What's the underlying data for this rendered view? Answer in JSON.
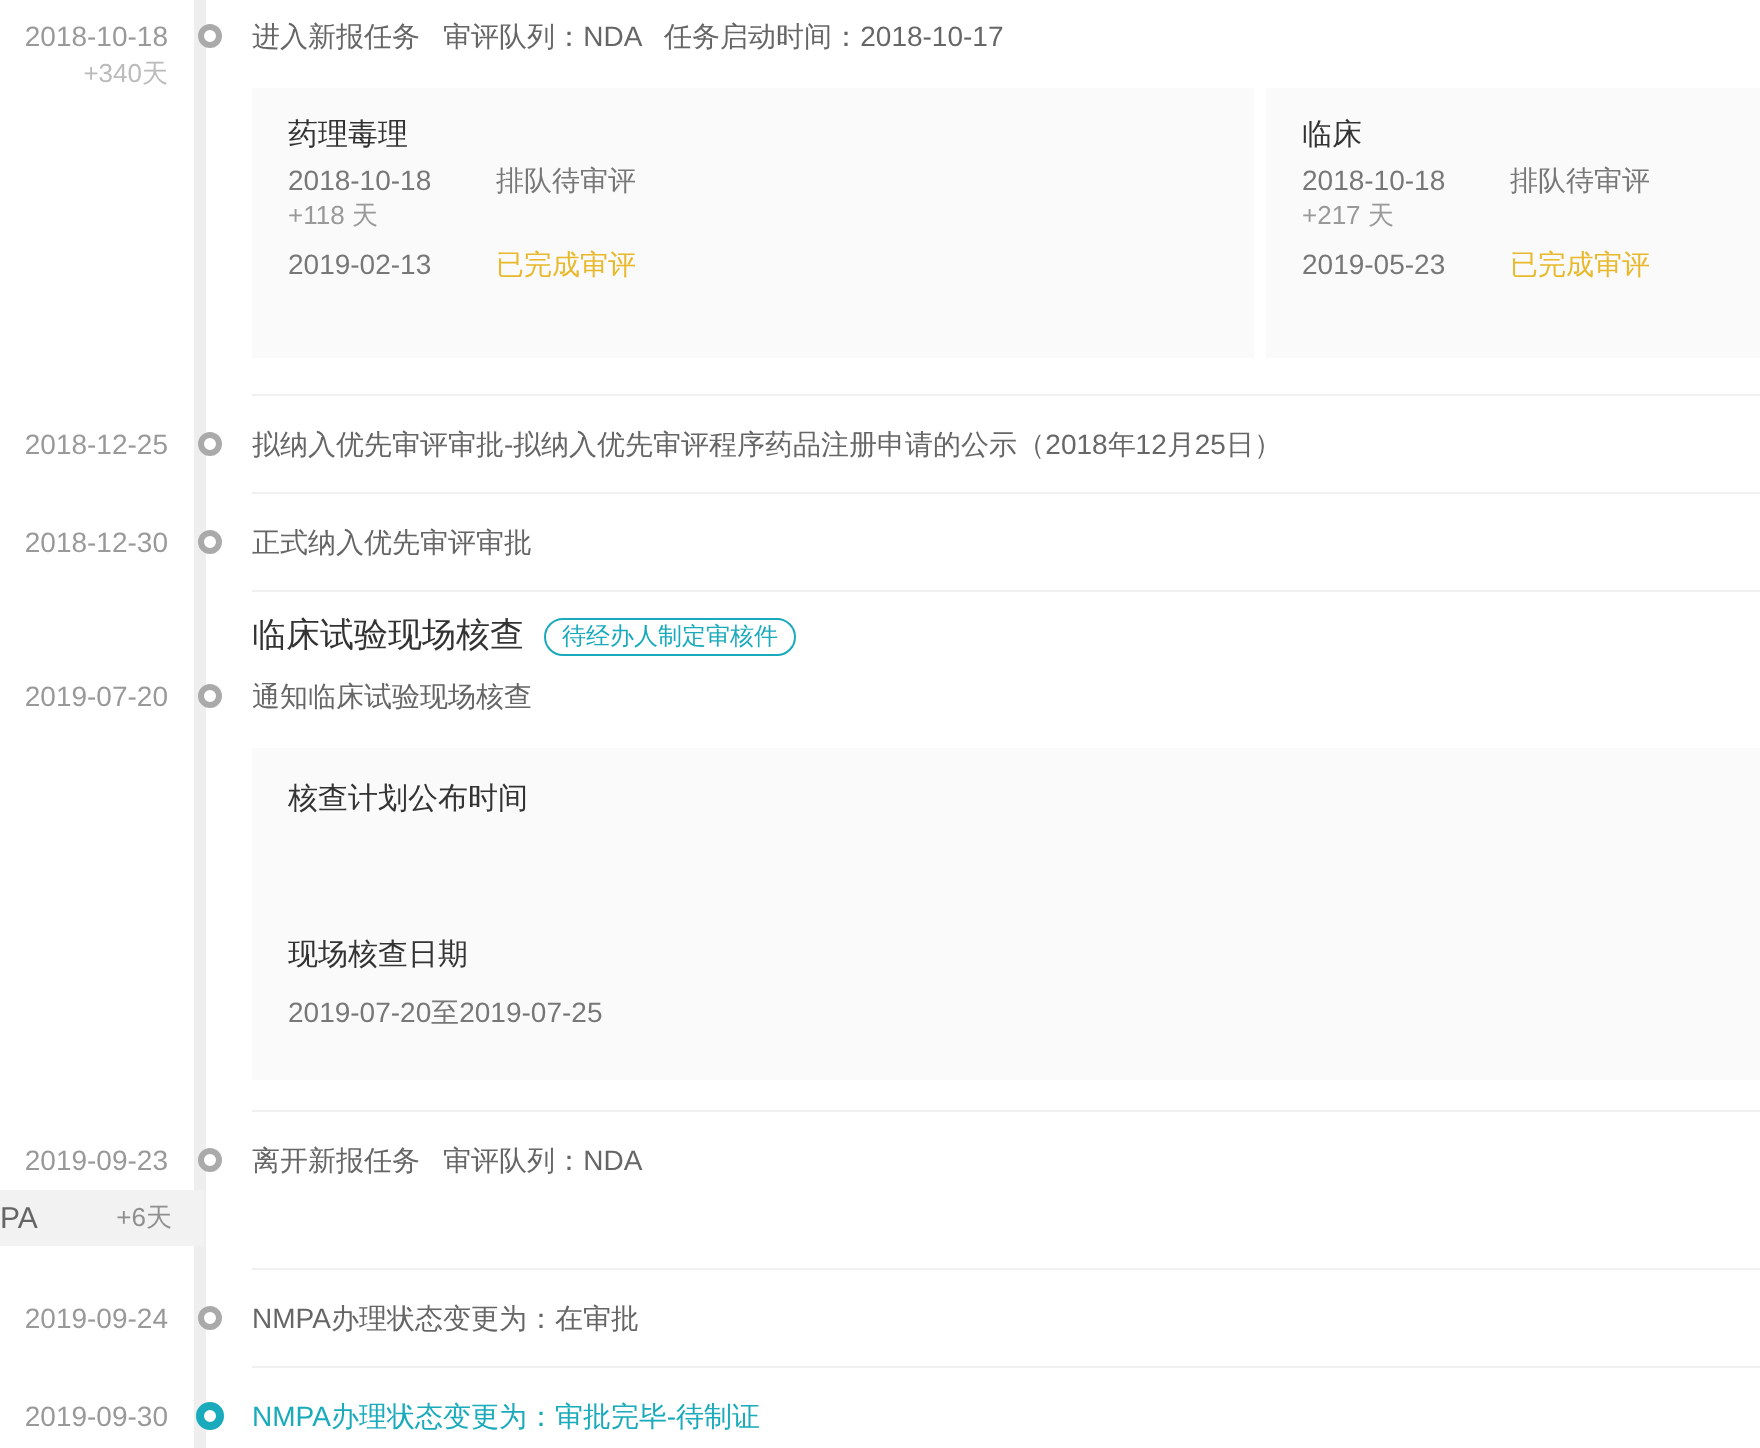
{
  "timeline": [
    {
      "kind": "event",
      "date": "2018-10-18",
      "note": "+340天",
      "current": false,
      "text": "进入新报任务   审评队列：NDA   任务启动时间：2018-10-17",
      "reviews": [
        {
          "title": "药理毒理",
          "steps": [
            {
              "date": "2018-10-18",
              "status": "排队待审评",
              "done": false,
              "duration": "+118 天"
            },
            {
              "date": "2019-02-13",
              "status": "已完成审评",
              "done": true
            }
          ]
        },
        {
          "title": "临床",
          "steps": [
            {
              "date": "2018-10-18",
              "status": "排队待审评",
              "done": false,
              "duration": "+217 天"
            },
            {
              "date": "2019-05-23",
              "status": "已完成审评",
              "done": true
            }
          ]
        }
      ]
    },
    {
      "kind": "event",
      "date": "2018-12-25",
      "current": false,
      "text": "拟纳入优先审评审批-拟纳入优先审评程序药品注册申请的公示（2018年12月25日）"
    },
    {
      "kind": "event",
      "date": "2018-12-30",
      "current": false,
      "text": "正式纳入优先审评审批"
    },
    {
      "kind": "section",
      "title": "临床试验现场核查",
      "tag": "待经办人制定审核件"
    },
    {
      "kind": "event",
      "date": "2019-07-20",
      "current": false,
      "text": "通知临床试验现场核查",
      "inspection": [
        {
          "label": "核查计划公布时间"
        },
        {
          "label": "现场核查日期",
          "value": "2019-07-20至2019-07-25"
        }
      ]
    },
    {
      "kind": "event",
      "date": "2019-09-23",
      "current": false,
      "text": "离开新报任务   审评队列：NDA",
      "band": {
        "label": "PA",
        "duration": "+6天"
      }
    },
    {
      "kind": "event",
      "date": "2019-09-24",
      "current": false,
      "text": "NMPA办理状态变更为：在审批"
    },
    {
      "kind": "event",
      "date": "2019-09-30",
      "current": true,
      "text": "NMPA办理状态变更为：审批完毕-待制证"
    }
  ]
}
